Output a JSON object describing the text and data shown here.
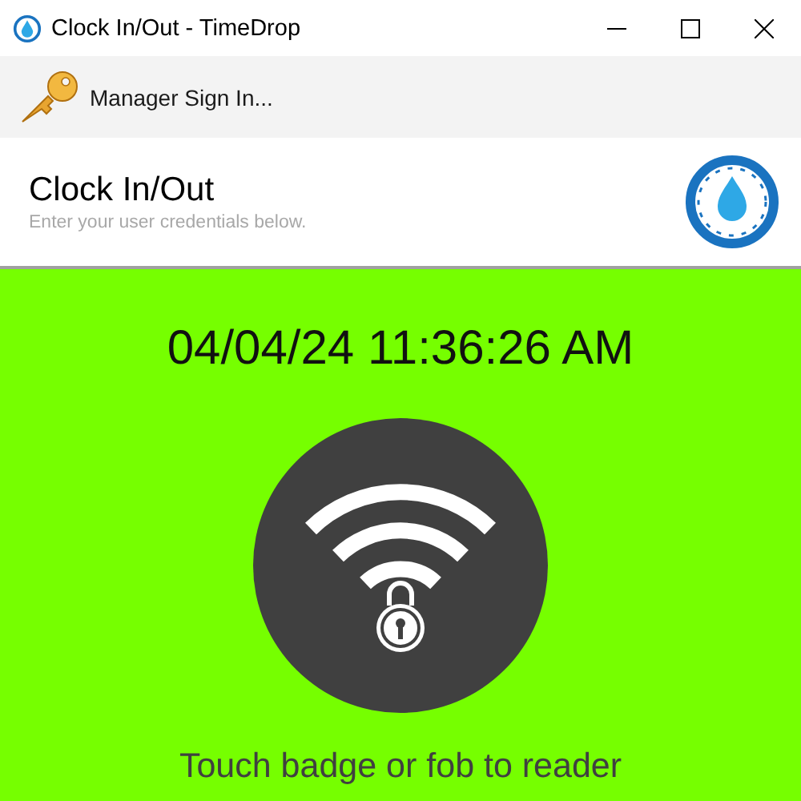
{
  "window": {
    "title": "Clock In/Out - TimeDrop"
  },
  "toolbar": {
    "manager_button": "Manager Sign In..."
  },
  "header": {
    "title": "Clock In/Out",
    "subtitle": "Enter your user credentials below."
  },
  "clock": {
    "datetime": "04/04/24 11:36:26 AM",
    "prompt": "Touch badge or fob to reader"
  }
}
